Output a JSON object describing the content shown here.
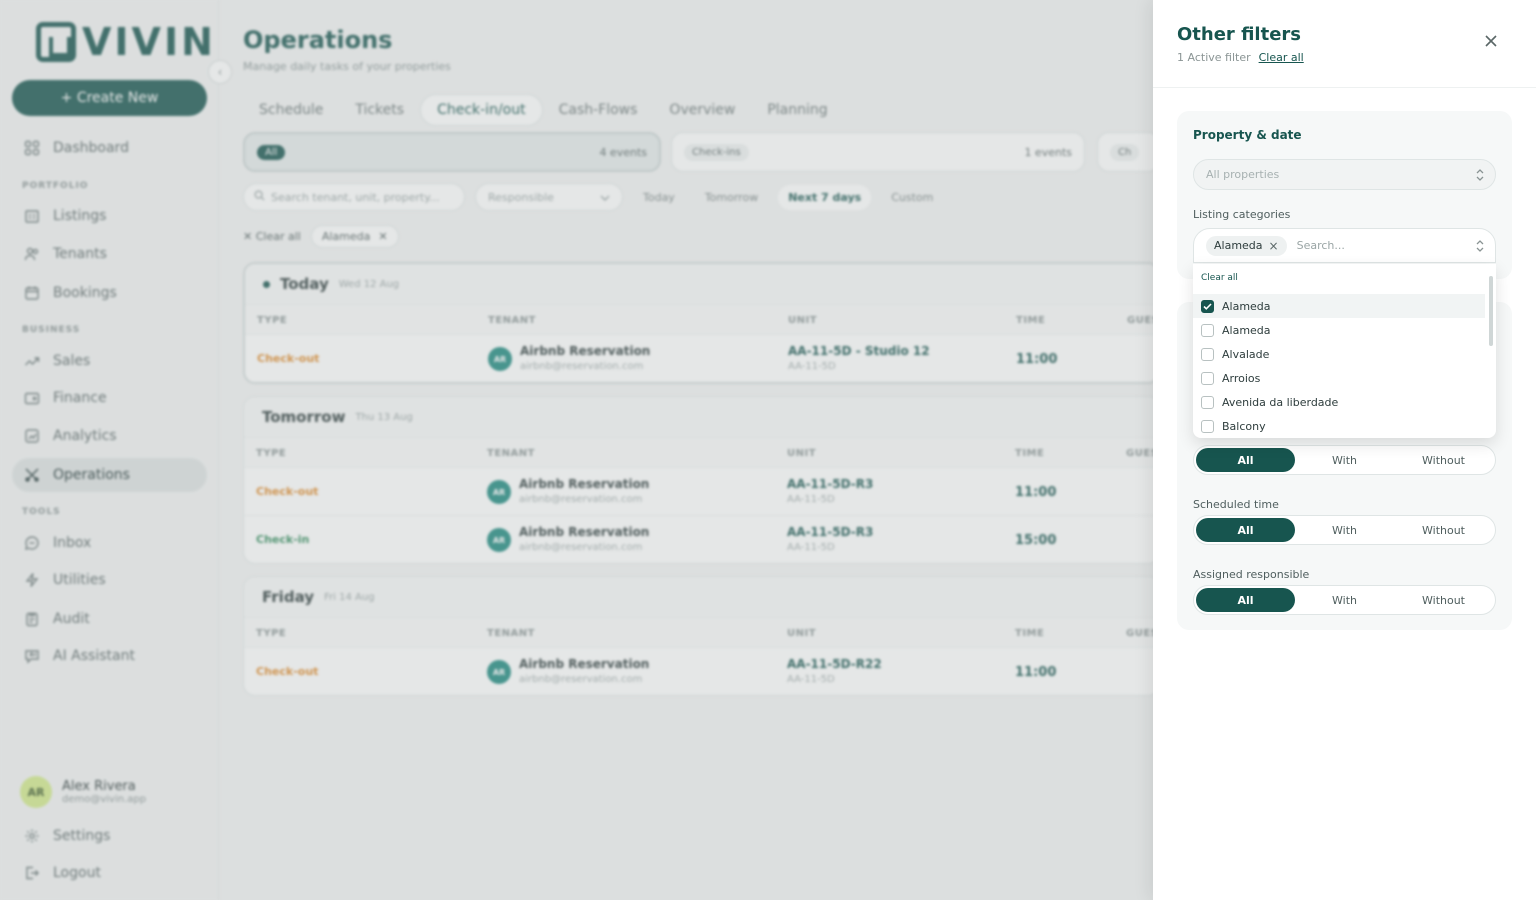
{
  "sidebar": {
    "logo": "VIVIN",
    "create_label": "+ Create New",
    "sections": {
      "portfolio": "PORTFOLIO",
      "business": "BUSINESS",
      "tools": "TOOLS"
    },
    "items": [
      {
        "label": "Dashboard",
        "icon": "grid-icon"
      },
      {
        "label": "Listings",
        "icon": "building-icon"
      },
      {
        "label": "Tenants",
        "icon": "users-icon"
      },
      {
        "label": "Bookings",
        "icon": "calendar-icon"
      },
      {
        "label": "Sales",
        "icon": "trend-icon"
      },
      {
        "label": "Finance",
        "icon": "wallet-icon"
      },
      {
        "label": "Analytics",
        "icon": "chart-icon"
      },
      {
        "label": "Operations",
        "icon": "tools-icon"
      },
      {
        "label": "Inbox",
        "icon": "chat-icon"
      },
      {
        "label": "Utilities",
        "icon": "bolt-icon"
      },
      {
        "label": "Audit",
        "icon": "clipboard-icon"
      },
      {
        "label": "AI Assistant",
        "icon": "ai-icon"
      }
    ],
    "user": {
      "initials": "AR",
      "name": "Alex Rivera",
      "email": "demo@vivin.app"
    },
    "settings": "Settings",
    "logout": "Logout"
  },
  "main": {
    "title": "Operations",
    "subtitle": "Manage daily tasks of your properties",
    "tabs": [
      "Schedule",
      "Tickets",
      "Check-in/out",
      "Cash-Flows",
      "Overview",
      "Planning"
    ],
    "summary": [
      {
        "label": "All",
        "count": "4 events"
      },
      {
        "label": "Check-ins",
        "count": "1 events"
      },
      {
        "label": "Ch"
      }
    ],
    "search_placeholder": "Search tenant, unit, property...",
    "responsible_placeholder": "Responsible",
    "quick_filters": [
      "Today",
      "Tomorrow",
      "Next 7 days",
      "Custom"
    ],
    "chips": {
      "clear": "Clear all",
      "active": "Alameda"
    },
    "columns": [
      "TYPE",
      "TENANT",
      "UNIT",
      "TIME",
      "GUES"
    ],
    "groups": [
      {
        "title": "Today",
        "date": "Wed 12 Aug",
        "rows": [
          {
            "type": "Check-out",
            "initials": "AR",
            "tenant": "Airbnb Reservation",
            "email": "airbnb@reservation.com",
            "unit": "AA-11-5D - Studio 12",
            "unit_sub": "AA-11-5D",
            "time": "11:00"
          }
        ]
      },
      {
        "title": "Tomorrow",
        "date": "Thu 13 Aug",
        "rows": [
          {
            "type": "Check-out",
            "initials": "AR",
            "tenant": "Airbnb Reservation",
            "email": "airbnb@reservation.com",
            "unit": "AA-11-5D-R3",
            "unit_sub": "AA-11-5D",
            "time": "11:00"
          },
          {
            "type": "Check-in",
            "initials": "AR",
            "tenant": "Airbnb Reservation",
            "email": "airbnb@reservation.com",
            "unit": "AA-11-5D-R3",
            "unit_sub": "AA-11-5D",
            "time": "15:00"
          }
        ]
      },
      {
        "title": "Friday",
        "date": "Fri 14 Aug",
        "rows": [
          {
            "type": "Check-out",
            "initials": "AR",
            "tenant": "Airbnb Reservation",
            "email": "airbnb@reservation.com",
            "unit": "AA-11-5D-R22",
            "unit_sub": "AA-11-5D",
            "time": "11:00"
          }
        ]
      }
    ]
  },
  "panel": {
    "title": "Other filters",
    "active_count": "1 Active filter",
    "clear_all": "Clear all",
    "section_title": "Property & date",
    "properties_placeholder": "All properties",
    "categories_label": "Listing categories",
    "selected_tag": "Alameda",
    "search_placeholder": "Search...",
    "dropdown": {
      "clear": "Clear all",
      "options": [
        {
          "label": "Alameda",
          "checked": true
        },
        {
          "label": "Alameda",
          "checked": false
        },
        {
          "label": "Alvalade",
          "checked": false
        },
        {
          "label": "Arroios",
          "checked": false
        },
        {
          "label": "Avenida da liberdade",
          "checked": false
        },
        {
          "label": "Balcony",
          "checked": false
        }
      ]
    },
    "segments": [
      {
        "label": "",
        "options": [
          "All",
          "With",
          "Without"
        ],
        "selected": "All"
      },
      {
        "label": "Scheduled time",
        "options": [
          "All",
          "With",
          "Without"
        ],
        "selected": "All"
      },
      {
        "label": "Assigned responsible",
        "options": [
          "All",
          "With",
          "Without"
        ],
        "selected": "All"
      }
    ]
  },
  "colors": {
    "brand": "#17554f",
    "checkout": "#e08a2a",
    "checkin": "#2f8a5a"
  }
}
